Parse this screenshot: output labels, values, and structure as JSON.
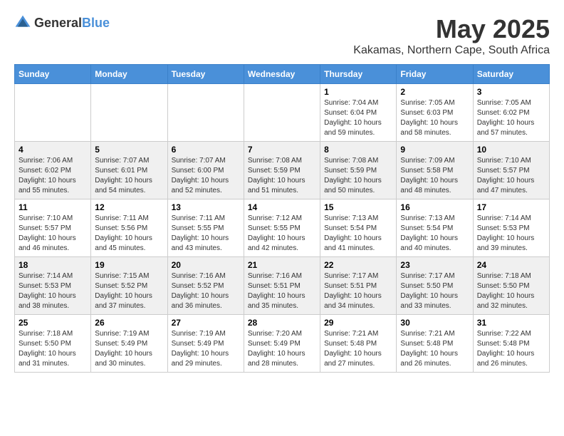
{
  "header": {
    "logo_general": "General",
    "logo_blue": "Blue",
    "month_year": "May 2025",
    "location": "Kakamas, Northern Cape, South Africa"
  },
  "weekdays": [
    "Sunday",
    "Monday",
    "Tuesday",
    "Wednesday",
    "Thursday",
    "Friday",
    "Saturday"
  ],
  "weeks": [
    [
      {
        "day": "",
        "info": ""
      },
      {
        "day": "",
        "info": ""
      },
      {
        "day": "",
        "info": ""
      },
      {
        "day": "",
        "info": ""
      },
      {
        "day": "1",
        "info": "Sunrise: 7:04 AM\nSunset: 6:04 PM\nDaylight: 10 hours\nand 59 minutes."
      },
      {
        "day": "2",
        "info": "Sunrise: 7:05 AM\nSunset: 6:03 PM\nDaylight: 10 hours\nand 58 minutes."
      },
      {
        "day": "3",
        "info": "Sunrise: 7:05 AM\nSunset: 6:02 PM\nDaylight: 10 hours\nand 57 minutes."
      }
    ],
    [
      {
        "day": "4",
        "info": "Sunrise: 7:06 AM\nSunset: 6:02 PM\nDaylight: 10 hours\nand 55 minutes."
      },
      {
        "day": "5",
        "info": "Sunrise: 7:07 AM\nSunset: 6:01 PM\nDaylight: 10 hours\nand 54 minutes."
      },
      {
        "day": "6",
        "info": "Sunrise: 7:07 AM\nSunset: 6:00 PM\nDaylight: 10 hours\nand 52 minutes."
      },
      {
        "day": "7",
        "info": "Sunrise: 7:08 AM\nSunset: 5:59 PM\nDaylight: 10 hours\nand 51 minutes."
      },
      {
        "day": "8",
        "info": "Sunrise: 7:08 AM\nSunset: 5:59 PM\nDaylight: 10 hours\nand 50 minutes."
      },
      {
        "day": "9",
        "info": "Sunrise: 7:09 AM\nSunset: 5:58 PM\nDaylight: 10 hours\nand 48 minutes."
      },
      {
        "day": "10",
        "info": "Sunrise: 7:10 AM\nSunset: 5:57 PM\nDaylight: 10 hours\nand 47 minutes."
      }
    ],
    [
      {
        "day": "11",
        "info": "Sunrise: 7:10 AM\nSunset: 5:57 PM\nDaylight: 10 hours\nand 46 minutes."
      },
      {
        "day": "12",
        "info": "Sunrise: 7:11 AM\nSunset: 5:56 PM\nDaylight: 10 hours\nand 45 minutes."
      },
      {
        "day": "13",
        "info": "Sunrise: 7:11 AM\nSunset: 5:55 PM\nDaylight: 10 hours\nand 43 minutes."
      },
      {
        "day": "14",
        "info": "Sunrise: 7:12 AM\nSunset: 5:55 PM\nDaylight: 10 hours\nand 42 minutes."
      },
      {
        "day": "15",
        "info": "Sunrise: 7:13 AM\nSunset: 5:54 PM\nDaylight: 10 hours\nand 41 minutes."
      },
      {
        "day": "16",
        "info": "Sunrise: 7:13 AM\nSunset: 5:54 PM\nDaylight: 10 hours\nand 40 minutes."
      },
      {
        "day": "17",
        "info": "Sunrise: 7:14 AM\nSunset: 5:53 PM\nDaylight: 10 hours\nand 39 minutes."
      }
    ],
    [
      {
        "day": "18",
        "info": "Sunrise: 7:14 AM\nSunset: 5:53 PM\nDaylight: 10 hours\nand 38 minutes."
      },
      {
        "day": "19",
        "info": "Sunrise: 7:15 AM\nSunset: 5:52 PM\nDaylight: 10 hours\nand 37 minutes."
      },
      {
        "day": "20",
        "info": "Sunrise: 7:16 AM\nSunset: 5:52 PM\nDaylight: 10 hours\nand 36 minutes."
      },
      {
        "day": "21",
        "info": "Sunrise: 7:16 AM\nSunset: 5:51 PM\nDaylight: 10 hours\nand 35 minutes."
      },
      {
        "day": "22",
        "info": "Sunrise: 7:17 AM\nSunset: 5:51 PM\nDaylight: 10 hours\nand 34 minutes."
      },
      {
        "day": "23",
        "info": "Sunrise: 7:17 AM\nSunset: 5:50 PM\nDaylight: 10 hours\nand 33 minutes."
      },
      {
        "day": "24",
        "info": "Sunrise: 7:18 AM\nSunset: 5:50 PM\nDaylight: 10 hours\nand 32 minutes."
      }
    ],
    [
      {
        "day": "25",
        "info": "Sunrise: 7:18 AM\nSunset: 5:50 PM\nDaylight: 10 hours\nand 31 minutes."
      },
      {
        "day": "26",
        "info": "Sunrise: 7:19 AM\nSunset: 5:49 PM\nDaylight: 10 hours\nand 30 minutes."
      },
      {
        "day": "27",
        "info": "Sunrise: 7:19 AM\nSunset: 5:49 PM\nDaylight: 10 hours\nand 29 minutes."
      },
      {
        "day": "28",
        "info": "Sunrise: 7:20 AM\nSunset: 5:49 PM\nDaylight: 10 hours\nand 28 minutes."
      },
      {
        "day": "29",
        "info": "Sunrise: 7:21 AM\nSunset: 5:48 PM\nDaylight: 10 hours\nand 27 minutes."
      },
      {
        "day": "30",
        "info": "Sunrise: 7:21 AM\nSunset: 5:48 PM\nDaylight: 10 hours\nand 26 minutes."
      },
      {
        "day": "31",
        "info": "Sunrise: 7:22 AM\nSunset: 5:48 PM\nDaylight: 10 hours\nand 26 minutes."
      }
    ]
  ]
}
